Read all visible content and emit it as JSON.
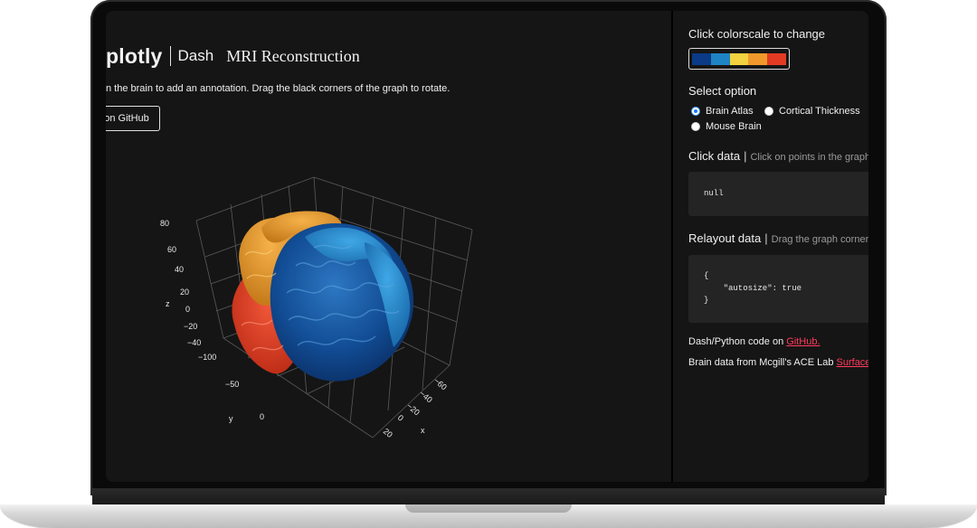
{
  "header": {
    "logo_plotly": "plotly",
    "logo_dash": "Dash",
    "title": "MRI Reconstruction",
    "instructions": "n the brain to add an annotation. Drag the black corners of the graph to rotate.",
    "github_button": "on GitHub"
  },
  "graph": {
    "z_axis_label": "z",
    "y_axis_label": "y",
    "x_axis_label": "x",
    "z_ticks": [
      "80",
      "60",
      "40",
      "20",
      "0",
      "−20",
      "−40"
    ],
    "y_ticks": [
      "−100",
      "−50",
      "0"
    ],
    "x_ticks": [
      "−60",
      "−40",
      "−20",
      "0",
      "20"
    ]
  },
  "sidebar": {
    "colorscale_heading": "Click colorscale to change",
    "colorscale": [
      "#0b3a86",
      "#1f84c4",
      "#f2d23f",
      "#f0992a",
      "#e33a24"
    ],
    "option_heading": "Select option",
    "options": [
      {
        "label": "Brain Atlas",
        "selected": true
      },
      {
        "label": "Cortical Thickness",
        "selected": false
      },
      {
        "label": "Mouse Brain",
        "selected": false
      }
    ],
    "click_data": {
      "heading": "Click data",
      "hint": "Click on points in the graph",
      "value": "null"
    },
    "relayout_data": {
      "heading": "Relayout data",
      "hint": "Drag the graph corner",
      "lines": [
        "{",
        "    \"autosize\": true",
        "}"
      ]
    },
    "footer1_text": "Dash/Python code on ",
    "footer1_link": "GitHub.",
    "footer2_text": "Brain data from Mcgill's ACE Lab ",
    "footer2_link": "Surface"
  }
}
